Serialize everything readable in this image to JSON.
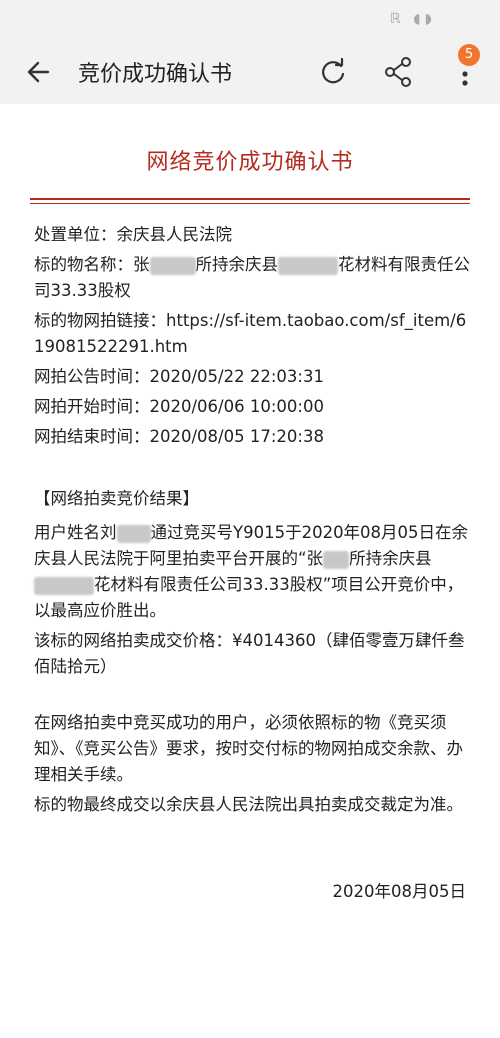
{
  "app": {
    "title": "竞价成功确认书",
    "badge_count": "5"
  },
  "document": {
    "heading": "网络竞价成功确认书",
    "disposal_unit": "处置单位：余庆县人民法院",
    "subject_name_a": "标的物名称：张",
    "subject_name_b": "所持余庆县",
    "subject_name_c": "花材料有限责任公司33.33股权",
    "link": "标的物网拍链接：https://sf-item.taobao.com/sf_item/619081522291.htm",
    "announce_time": "网拍公告时间：2020/05/22 22:03:31",
    "start_time": "网拍开始时间：2020/06/06 10:00:00",
    "end_time": "网拍结束时间：2020/08/05 17:20:38",
    "result_heading": "【网络拍卖竞价结果】",
    "result_a": "用户姓名刘",
    "result_b": "通过竞买号Y9015于2020年08月05日在余庆县人民法院于阿里拍卖平台开展的“张",
    "result_c": "所持余庆县",
    "result_d": "花材料有限责任公司33.33股权”项目公开竞价中，以最高应价胜出。",
    "price": "该标的网络拍卖成交价格：¥4014360（肆佰零壹万肆仟叁佰陆拾元）",
    "notice_1": "在网络拍卖中竞买成功的用户，必须依照标的物《竞买须知》、《竞买公告》要求，按时交付标的物网拍成交余款、办理相关手续。",
    "notice_2": "标的物最终成交以余庆县人民法院出具拍卖成交裁定为准。",
    "date": "2020年08月05日"
  },
  "icons": [
    "back-arrow-icon",
    "refresh-icon",
    "share-icon",
    "more-icon"
  ],
  "colors": {
    "accent": "#b62b1f",
    "badge": "#f0762f"
  }
}
